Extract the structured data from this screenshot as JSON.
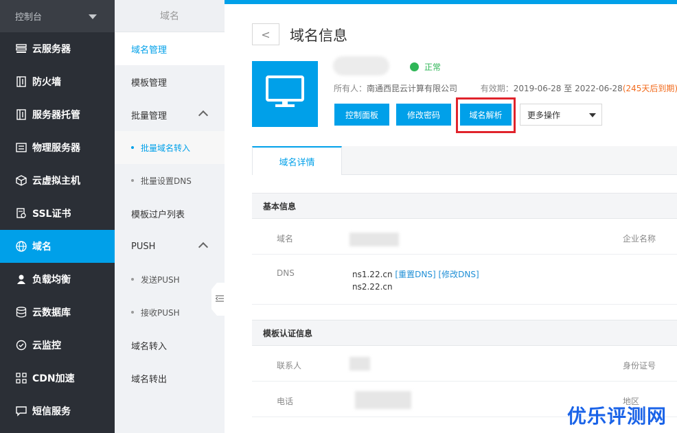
{
  "sidebar": {
    "header": "控制台",
    "items": [
      {
        "label": "云服务器",
        "icon": "server-icon"
      },
      {
        "label": "防火墙",
        "icon": "firewall-icon"
      },
      {
        "label": "服务器托管",
        "icon": "hosting-icon"
      },
      {
        "label": "物理服务器",
        "icon": "physical-server-icon"
      },
      {
        "label": "云虚拟主机",
        "icon": "cube-icon"
      },
      {
        "label": "SSL证书",
        "icon": "certificate-icon"
      },
      {
        "label": "域名",
        "icon": "globe-icon"
      },
      {
        "label": "负载均衡",
        "icon": "balance-icon"
      },
      {
        "label": "云数据库",
        "icon": "database-icon"
      },
      {
        "label": "云监控",
        "icon": "monitor-icon"
      },
      {
        "label": "CDN加速",
        "icon": "cdn-icon"
      },
      {
        "label": "短信服务",
        "icon": "sms-icon"
      }
    ]
  },
  "subnav": {
    "title": "域名",
    "items": [
      {
        "label": "域名管理"
      },
      {
        "label": "模板管理"
      },
      {
        "label": "批量管理"
      },
      {
        "label": "批量域名转入"
      },
      {
        "label": "批量设置DNS"
      },
      {
        "label": "模板过户列表"
      },
      {
        "label": "PUSH"
      },
      {
        "label": "发送PUSH"
      },
      {
        "label": "接收PUSH"
      },
      {
        "label": "域名转入"
      },
      {
        "label": "域名转出"
      }
    ]
  },
  "header": {
    "back": "<",
    "title": "域名信息"
  },
  "domain": {
    "status": "正常",
    "owner_label": "所有人：",
    "owner": "南通西昆云计算有限公司",
    "validity_label": "有效期：",
    "validity": "2019-06-28 至 2022-06-28",
    "expiry_note": "(245天后到期)"
  },
  "actions": {
    "control_panel": "控制面板",
    "change_password": "修改密码",
    "dns_resolve": "域名解析",
    "more": "更多操作"
  },
  "tabs": [
    "域名详情"
  ],
  "basic": {
    "section": "基本信息",
    "domain_label": "域名",
    "company_label": "企业名称",
    "dns_label": "DNS",
    "dns1": "ns1.22.cn",
    "reset_dns": "[重置DNS]",
    "modify_dns": "[修改DNS]",
    "dns2": "ns2.22.cn"
  },
  "template": {
    "section": "模板认证信息",
    "contact_label": "联系人",
    "id_label": "身份证号",
    "phone_label": "电话",
    "region_label": "地区"
  },
  "watermark": "优乐评测网",
  "colors": {
    "accent": "#00a0e9",
    "sidebar_bg": "#2b2f36",
    "status_green": "#2fb657",
    "warning": "#f26b1d",
    "highlight_red": "#e0232b"
  }
}
